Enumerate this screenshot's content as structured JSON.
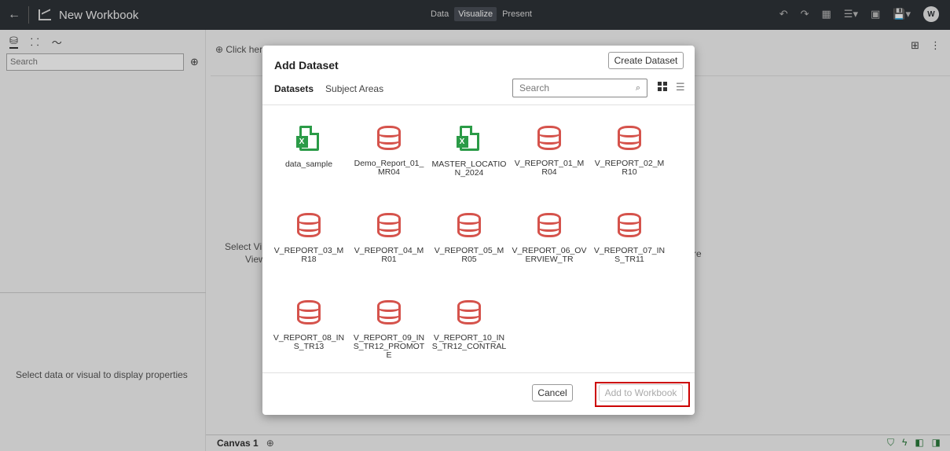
{
  "header": {
    "back_icon": "back-arrow-icon",
    "title": "New Workbook",
    "modes": [
      "Data",
      "Visualize",
      "Present"
    ],
    "active_mode": "Visualize",
    "user_initial": "W"
  },
  "left_panel": {
    "search_placeholder": "Search",
    "properties_hint": "Select data or visual to display properties"
  },
  "canvas": {
    "hint": "⊕ Click her",
    "select_text_line1": "Select Vi",
    "select_text_line2": "View",
    "right_text": "re",
    "tab_label": "Canvas 1"
  },
  "modal": {
    "title": "Add Dataset",
    "create_button": "Create Dataset",
    "tabs": [
      "Datasets",
      "Subject Areas"
    ],
    "active_tab": "Datasets",
    "search_placeholder": "Search",
    "datasets": [
      {
        "label": "data_sample",
        "icon": "excel-file-icon"
      },
      {
        "label": "Demo_Report_01_MR04",
        "icon": "database-icon"
      },
      {
        "label": "MASTER_LOCATION_2024",
        "icon": "excel-file-icon"
      },
      {
        "label": "V_REPORT_01_MR04",
        "icon": "database-icon"
      },
      {
        "label": "V_REPORT_02_MR10",
        "icon": "database-icon"
      },
      {
        "label": "V_REPORT_03_MR18",
        "icon": "database-icon"
      },
      {
        "label": "V_REPORT_04_MR01",
        "icon": "database-icon"
      },
      {
        "label": "V_REPORT_05_MR05",
        "icon": "database-icon"
      },
      {
        "label": "V_REPORT_06_OVERVIEW_TR",
        "icon": "database-icon"
      },
      {
        "label": "V_REPORT_07_INS_TR11",
        "icon": "database-icon"
      },
      {
        "label": "V_REPORT_08_INS_TR13",
        "icon": "database-icon"
      },
      {
        "label": "V_REPORT_09_INS_TR12_PROMOTE",
        "icon": "database-icon"
      },
      {
        "label": "V_REPORT_10_INS_TR12_CONTRAL",
        "icon": "database-icon"
      }
    ],
    "cancel_button": "Cancel",
    "add_button": "Add to Workbook"
  },
  "colors": {
    "header_bg": "#2e3238",
    "database_icon": "#d5534c",
    "excel_icon": "#2b9b47",
    "highlight_box": "#cc0000"
  }
}
